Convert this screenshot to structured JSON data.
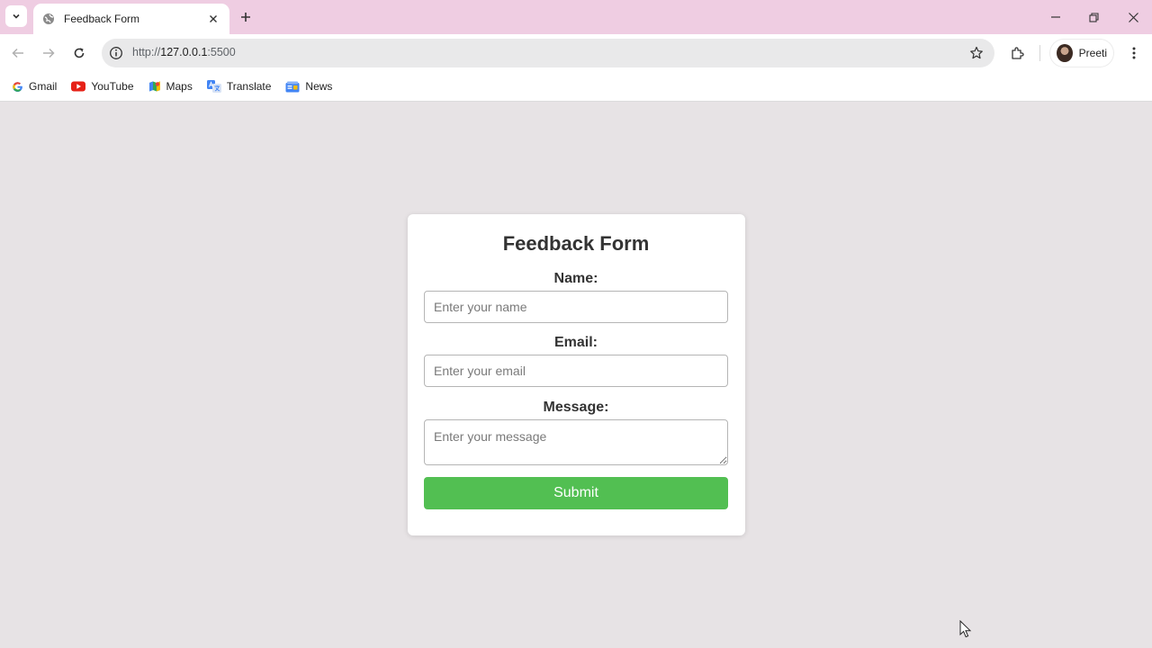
{
  "browser": {
    "tab": {
      "title": "Feedback Form"
    },
    "omnibox": {
      "scheme": "http://",
      "host": "127.0.0.1",
      "port": ":5500"
    },
    "profile": {
      "name": "Preeti"
    },
    "bookmarks": [
      {
        "label": "Gmail",
        "icon": "google-icon"
      },
      {
        "label": "YouTube",
        "icon": "youtube-icon"
      },
      {
        "label": "Maps",
        "icon": "maps-icon"
      },
      {
        "label": "Translate",
        "icon": "translate-icon"
      },
      {
        "label": "News",
        "icon": "news-icon"
      }
    ]
  },
  "form": {
    "title": "Feedback Form",
    "name_label": "Name:",
    "name_placeholder": "Enter your name",
    "email_label": "Email:",
    "email_placeholder": "Enter your email",
    "message_label": "Message:",
    "message_placeholder": "Enter your message",
    "submit_label": "Submit"
  },
  "colors": {
    "tabstrip": "#efcde2",
    "page_background": "#e7e3e5",
    "submit": "#52bf52",
    "text": "#333333"
  }
}
